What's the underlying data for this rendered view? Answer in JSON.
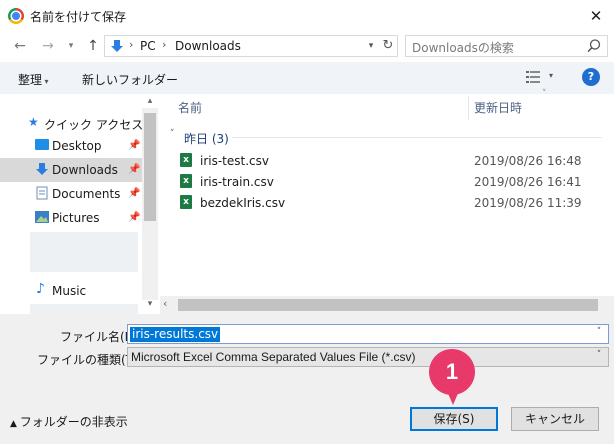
{
  "window": {
    "title": "名前を付けて保存"
  },
  "address": {
    "path": [
      "PC",
      "Downloads"
    ],
    "search_placeholder": "Downloadsの検索"
  },
  "toolbar": {
    "organize": "整理",
    "new_folder": "新しいフォルダー",
    "help": "?"
  },
  "sidebar": {
    "quick_access": "クイック アクセス",
    "items": [
      {
        "label": "Desktop",
        "icon": "desktop-folder-icon"
      },
      {
        "label": "Downloads",
        "icon": "downloads-folder-icon"
      },
      {
        "label": "Documents",
        "icon": "documents-folder-icon"
      },
      {
        "label": "Pictures",
        "icon": "pictures-folder-icon"
      },
      {
        "label": "Music",
        "icon": "music-icon"
      }
    ]
  },
  "columns": {
    "name": "名前",
    "date": "更新日時"
  },
  "group": {
    "label": "昨日 (3)"
  },
  "files": [
    {
      "name": "iris-test.csv",
      "date": "2019/08/26 16:48"
    },
    {
      "name": "iris-train.csv",
      "date": "2019/08/26 16:41"
    },
    {
      "name": "bezdekIris.csv",
      "date": "2019/08/26 11:39"
    }
  ],
  "form": {
    "filename_label": "ファイル名(N):",
    "filename_value": "iris-results.csv",
    "filetype_label": "ファイルの種類(T):",
    "filetype_value": "Microsoft Excel Comma Separated Values File (*.csv)"
  },
  "footer": {
    "hide_folders": "フォルダーの非表示",
    "save": "保存(S)",
    "cancel": "キャンセル"
  },
  "callout": {
    "number": "1"
  },
  "colors": {
    "accent": "#0078d7",
    "callout": "#e8396b",
    "excel": "#1d7a44",
    "help": "#1f6fd1"
  }
}
